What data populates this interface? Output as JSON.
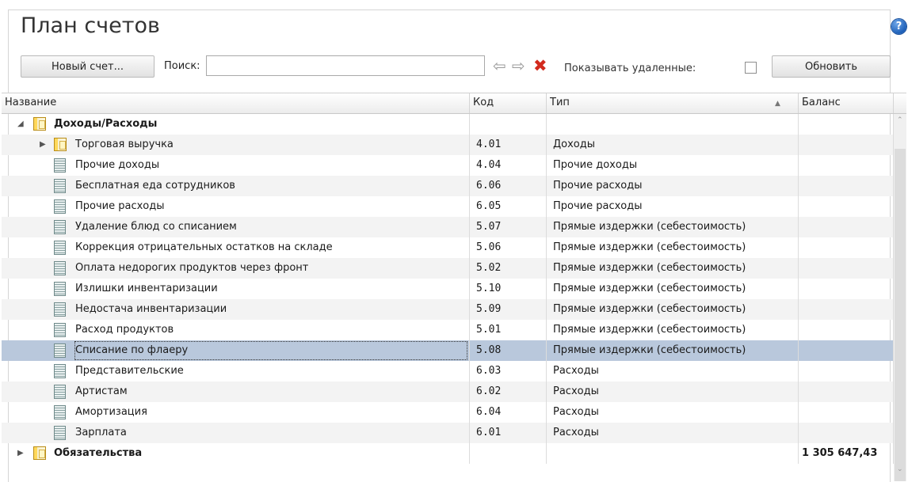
{
  "title": "План счетов",
  "toolbar": {
    "new_account": "Новый счет...",
    "search_label": "Поиск:",
    "search_value": "",
    "show_deleted_label": "Показывать удаленные:",
    "show_deleted_checked": false,
    "refresh": "Обновить"
  },
  "columns": {
    "name": "Название",
    "code": "Код",
    "type": "Тип",
    "balance": "Баланс"
  },
  "rows": [
    {
      "name": "Доходы/Расходы",
      "code": "",
      "type": "",
      "balance": ""
    },
    {
      "name": "Торговая выручка",
      "code": "4.01",
      "type": "Доходы",
      "balance": ""
    },
    {
      "name": "Прочие доходы",
      "code": "4.04",
      "type": "Прочие доходы",
      "balance": ""
    },
    {
      "name": "Бесплатная еда сотрудников",
      "code": "6.06",
      "type": "Прочие расходы",
      "balance": ""
    },
    {
      "name": "Прочие расходы",
      "code": "6.05",
      "type": "Прочие расходы",
      "balance": ""
    },
    {
      "name": "Удаление блюд со списанием",
      "code": "5.07",
      "type": "Прямые издержки (себестоимость)",
      "balance": ""
    },
    {
      "name": "Коррекция отрицательных остатков на складе",
      "code": "5.06",
      "type": "Прямые издержки (себестоимость)",
      "balance": ""
    },
    {
      "name": "Оплата недорогих продуктов через фронт",
      "code": "5.02",
      "type": "Прямые издержки (себестоимость)",
      "balance": ""
    },
    {
      "name": "Излишки инвентаризации",
      "code": "5.10",
      "type": "Прямые издержки (себестоимость)",
      "balance": ""
    },
    {
      "name": "Недостача инвентаризации",
      "code": "5.09",
      "type": "Прямые издержки (себестоимость)",
      "balance": ""
    },
    {
      "name": "Расход продуктов",
      "code": "5.01",
      "type": "Прямые издержки (себестоимость)",
      "balance": ""
    },
    {
      "name": "Списание по флаеру",
      "code": "5.08",
      "type": "Прямые издержки (себестоимость)",
      "balance": ""
    },
    {
      "name": "Представительские",
      "code": "6.03",
      "type": "Расходы",
      "balance": ""
    },
    {
      "name": "Артистам",
      "code": "6.02",
      "type": "Расходы",
      "balance": ""
    },
    {
      "name": "Амортизация",
      "code": "6.04",
      "type": "Расходы",
      "balance": ""
    },
    {
      "name": "Зарплата",
      "code": "6.01",
      "type": "Расходы",
      "balance": ""
    },
    {
      "name": "Обязательства",
      "code": "",
      "type": "",
      "balance": "1 305 647,43"
    }
  ]
}
